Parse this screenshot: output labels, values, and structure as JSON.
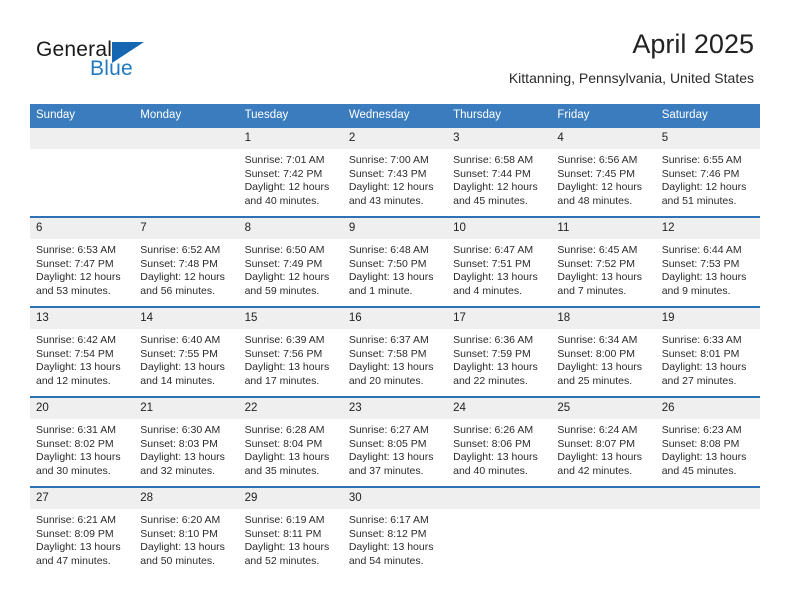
{
  "brand": {
    "name_part1": "General",
    "name_part2": "Blue"
  },
  "header": {
    "title": "April 2025",
    "location": "Kittanning, Pennsylvania, United States"
  },
  "calendar": {
    "weekday_headers": [
      "Sunday",
      "Monday",
      "Tuesday",
      "Wednesday",
      "Thursday",
      "Friday",
      "Saturday"
    ],
    "accent_header_color": "#3a7cbe",
    "row_divider_color": "#2e72b4",
    "daynum_band_color": "#efefef",
    "weeks": [
      [
        {
          "day": "",
          "empty": true
        },
        {
          "day": "",
          "empty": true
        },
        {
          "day": "1",
          "sunrise": "Sunrise: 7:01 AM",
          "sunset": "Sunset: 7:42 PM",
          "daylight": "Daylight: 12 hours and 40 minutes."
        },
        {
          "day": "2",
          "sunrise": "Sunrise: 7:00 AM",
          "sunset": "Sunset: 7:43 PM",
          "daylight": "Daylight: 12 hours and 43 minutes."
        },
        {
          "day": "3",
          "sunrise": "Sunrise: 6:58 AM",
          "sunset": "Sunset: 7:44 PM",
          "daylight": "Daylight: 12 hours and 45 minutes."
        },
        {
          "day": "4",
          "sunrise": "Sunrise: 6:56 AM",
          "sunset": "Sunset: 7:45 PM",
          "daylight": "Daylight: 12 hours and 48 minutes."
        },
        {
          "day": "5",
          "sunrise": "Sunrise: 6:55 AM",
          "sunset": "Sunset: 7:46 PM",
          "daylight": "Daylight: 12 hours and 51 minutes."
        }
      ],
      [
        {
          "day": "6",
          "sunrise": "Sunrise: 6:53 AM",
          "sunset": "Sunset: 7:47 PM",
          "daylight": "Daylight: 12 hours and 53 minutes."
        },
        {
          "day": "7",
          "sunrise": "Sunrise: 6:52 AM",
          "sunset": "Sunset: 7:48 PM",
          "daylight": "Daylight: 12 hours and 56 minutes."
        },
        {
          "day": "8",
          "sunrise": "Sunrise: 6:50 AM",
          "sunset": "Sunset: 7:49 PM",
          "daylight": "Daylight: 12 hours and 59 minutes."
        },
        {
          "day": "9",
          "sunrise": "Sunrise: 6:48 AM",
          "sunset": "Sunset: 7:50 PM",
          "daylight": "Daylight: 13 hours and 1 minute."
        },
        {
          "day": "10",
          "sunrise": "Sunrise: 6:47 AM",
          "sunset": "Sunset: 7:51 PM",
          "daylight": "Daylight: 13 hours and 4 minutes."
        },
        {
          "day": "11",
          "sunrise": "Sunrise: 6:45 AM",
          "sunset": "Sunset: 7:52 PM",
          "daylight": "Daylight: 13 hours and 7 minutes."
        },
        {
          "day": "12",
          "sunrise": "Sunrise: 6:44 AM",
          "sunset": "Sunset: 7:53 PM",
          "daylight": "Daylight: 13 hours and 9 minutes."
        }
      ],
      [
        {
          "day": "13",
          "sunrise": "Sunrise: 6:42 AM",
          "sunset": "Sunset: 7:54 PM",
          "daylight": "Daylight: 13 hours and 12 minutes."
        },
        {
          "day": "14",
          "sunrise": "Sunrise: 6:40 AM",
          "sunset": "Sunset: 7:55 PM",
          "daylight": "Daylight: 13 hours and 14 minutes."
        },
        {
          "day": "15",
          "sunrise": "Sunrise: 6:39 AM",
          "sunset": "Sunset: 7:56 PM",
          "daylight": "Daylight: 13 hours and 17 minutes."
        },
        {
          "day": "16",
          "sunrise": "Sunrise: 6:37 AM",
          "sunset": "Sunset: 7:58 PM",
          "daylight": "Daylight: 13 hours and 20 minutes."
        },
        {
          "day": "17",
          "sunrise": "Sunrise: 6:36 AM",
          "sunset": "Sunset: 7:59 PM",
          "daylight": "Daylight: 13 hours and 22 minutes."
        },
        {
          "day": "18",
          "sunrise": "Sunrise: 6:34 AM",
          "sunset": "Sunset: 8:00 PM",
          "daylight": "Daylight: 13 hours and 25 minutes."
        },
        {
          "day": "19",
          "sunrise": "Sunrise: 6:33 AM",
          "sunset": "Sunset: 8:01 PM",
          "daylight": "Daylight: 13 hours and 27 minutes."
        }
      ],
      [
        {
          "day": "20",
          "sunrise": "Sunrise: 6:31 AM",
          "sunset": "Sunset: 8:02 PM",
          "daylight": "Daylight: 13 hours and 30 minutes."
        },
        {
          "day": "21",
          "sunrise": "Sunrise: 6:30 AM",
          "sunset": "Sunset: 8:03 PM",
          "daylight": "Daylight: 13 hours and 32 minutes."
        },
        {
          "day": "22",
          "sunrise": "Sunrise: 6:28 AM",
          "sunset": "Sunset: 8:04 PM",
          "daylight": "Daylight: 13 hours and 35 minutes."
        },
        {
          "day": "23",
          "sunrise": "Sunrise: 6:27 AM",
          "sunset": "Sunset: 8:05 PM",
          "daylight": "Daylight: 13 hours and 37 minutes."
        },
        {
          "day": "24",
          "sunrise": "Sunrise: 6:26 AM",
          "sunset": "Sunset: 8:06 PM",
          "daylight": "Daylight: 13 hours and 40 minutes."
        },
        {
          "day": "25",
          "sunrise": "Sunrise: 6:24 AM",
          "sunset": "Sunset: 8:07 PM",
          "daylight": "Daylight: 13 hours and 42 minutes."
        },
        {
          "day": "26",
          "sunrise": "Sunrise: 6:23 AM",
          "sunset": "Sunset: 8:08 PM",
          "daylight": "Daylight: 13 hours and 45 minutes."
        }
      ],
      [
        {
          "day": "27",
          "sunrise": "Sunrise: 6:21 AM",
          "sunset": "Sunset: 8:09 PM",
          "daylight": "Daylight: 13 hours and 47 minutes."
        },
        {
          "day": "28",
          "sunrise": "Sunrise: 6:20 AM",
          "sunset": "Sunset: 8:10 PM",
          "daylight": "Daylight: 13 hours and 50 minutes."
        },
        {
          "day": "29",
          "sunrise": "Sunrise: 6:19 AM",
          "sunset": "Sunset: 8:11 PM",
          "daylight": "Daylight: 13 hours and 52 minutes."
        },
        {
          "day": "30",
          "sunrise": "Sunrise: 6:17 AM",
          "sunset": "Sunset: 8:12 PM",
          "daylight": "Daylight: 13 hours and 54 minutes."
        },
        {
          "day": "",
          "empty": true
        },
        {
          "day": "",
          "empty": true
        },
        {
          "day": "",
          "empty": true
        }
      ]
    ]
  }
}
